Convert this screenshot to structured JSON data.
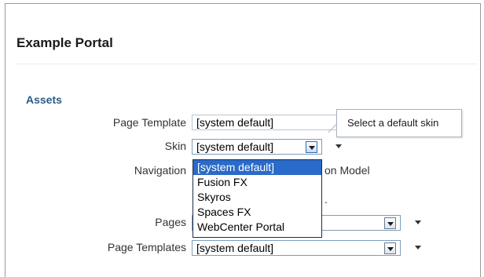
{
  "portal": {
    "title": "Example Portal"
  },
  "section": {
    "title": "Assets"
  },
  "fields": {
    "page_template": {
      "label": "Page Template",
      "value": "[system default]"
    },
    "skin": {
      "label": "Skin",
      "value": "[system default]"
    },
    "navigation": {
      "label": "Navigation",
      "value_fragment": "on Model",
      "extra_fragment": "."
    },
    "pages": {
      "label": "Pages"
    },
    "page_templates": {
      "label": "Page Templates",
      "value": "[system default]"
    }
  },
  "tooltip": {
    "text": "Select a default skin"
  },
  "skin_dropdown": {
    "options": [
      "[system default]",
      "Fusion FX",
      "Skyros",
      "Spaces FX",
      "WebCenter Portal"
    ],
    "selected_index": 0
  }
}
